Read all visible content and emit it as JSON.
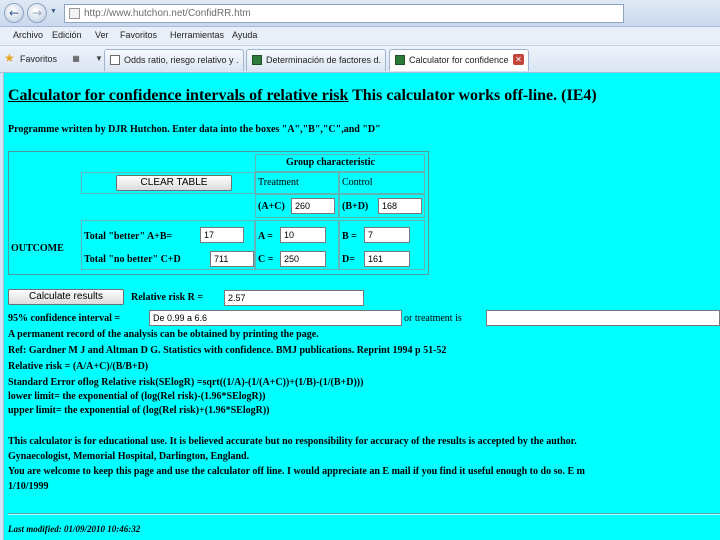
{
  "browser": {
    "url": "http://www.hutchon.net/ConfidRR.htm",
    "menu": [
      "Archivo",
      "Edición",
      "Ver",
      "Favoritos",
      "Herramientas",
      "Ayuda"
    ],
    "favorites_label": "Favoritos",
    "tabs": [
      {
        "label": "Odds ratio, riesgo relativo y ..."
      },
      {
        "label": "Determinación de factores d..."
      },
      {
        "label": "Calculator for confidence ..."
      }
    ]
  },
  "page": {
    "title_underlined": "Calculator for confidence intervals of relative risk",
    "title_rest": " This calculator works off-line. (IE4)",
    "byline": "Programme written by DJR Hutchon. Enter data into the boxes \"A\",\"B\",\"C\",and \"D\"",
    "group_characteristic": "Group characteristic",
    "clear_button": "CLEAR TABLE",
    "treatment_header": "Treatment",
    "control_header": "Control",
    "ac_label": "(A+C)",
    "ac_value": "260",
    "bd_label": "(B+D)",
    "bd_value": "168",
    "outcome_label": "OUTCOME",
    "better_label": "Total \"better\" A+B=",
    "better_value": "17",
    "a_label": "A =",
    "a_value": "10",
    "b_label": "B =",
    "b_value": "7",
    "nobetter_label": "Total \"no better\" C+D",
    "nobetter_value": "711",
    "c_label": "C =",
    "c_value": "250",
    "d_label": "D=",
    "d_value": "161",
    "calculate_button": "Calculate results",
    "rr_label": "Relative risk R =",
    "rr_value": "2.57",
    "ci_label": "95% confidence interval =",
    "ci_value": "De 0.99 a 6.6",
    "or_treatment_label": "or treatment is",
    "or_treatment_value": "",
    "lines": [
      "A permanent record of the analysis can be obtained by printing the page.",
      "Ref: Gardner M J and Altman D G. Statistics with confidence. BMJ publications. Reprint 1994 p 51-52",
      "Relative risk = (A/A+C)/(B/B+D)",
      "Standard Error oflog Relative risk(SElogR) =sqrt((1/A)-(1/(A+C))+(1/B)-(1/(B+D)))",
      "lower limit= the exponential of (log(Rel risk)-(1.96*SElogR))",
      "upper limit= the exponential of (log(Rel risk)+(1.96*SElogR))"
    ],
    "disclaimer": [
      "This calculator is for educational use. It is believed accurate but no responsibility for accuracy of the results is accepted by the author.",
      "Gynaecologist, Memorial Hospital, Darlington, England.",
      "You are welcome to keep this page and use the calculator off line. I would appreciate an E mail if you find it useful enough to do so. E m",
      "1/10/1999"
    ],
    "last_modified": "Last modified: 01/09/2010 10:46:32"
  }
}
